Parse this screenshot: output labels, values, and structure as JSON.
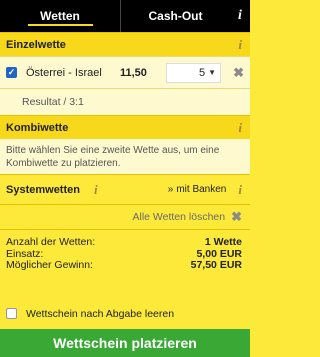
{
  "tabs": {
    "bets": "Wetten",
    "cashout": "Cash-Out",
    "info": "i"
  },
  "single": {
    "title": "Einzelwette",
    "info": "i",
    "bet": {
      "check": "✓",
      "match": "Österrei - Israel",
      "odds": "11,50",
      "stake": "5",
      "remove": "✖"
    },
    "result": "Resultat / 3:1"
  },
  "combo": {
    "title": "Kombiwette",
    "info": "i",
    "hint": "Bitte wählen Sie eine zweite Wette aus, um eine Kombiwette zu platzieren."
  },
  "system": {
    "title": "Systemwetten",
    "info": "i",
    "banks_arrow": "»",
    "banks_label": "mit Banken",
    "info_right": "i"
  },
  "clear": {
    "label": "Alle Wetten löschen",
    "icon": "✖"
  },
  "summary": {
    "count_label": "Anzahl der Wetten:",
    "count_value": "1 Wette",
    "stake_label": "Einsatz:",
    "stake_value": "5,00 EUR",
    "win_label": "Möglicher Gewinn:",
    "win_value": "57,50 EUR"
  },
  "options": {
    "empty_label": "Wettschein nach Abgabe leeren"
  },
  "submit": {
    "label": "Wettschein platzieren"
  },
  "colors": {
    "header_bg": "#000000",
    "panel": "#fde93a",
    "section": "#f7d81b",
    "row": "#fff9cf",
    "button": "#3aa835",
    "checkbox": "#1f64c8"
  }
}
